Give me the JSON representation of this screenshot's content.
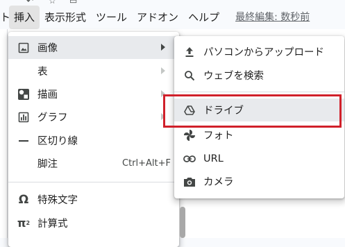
{
  "menubar": {
    "items": [
      {
        "label": "ト"
      },
      {
        "label": "挿入"
      },
      {
        "label": "表示形式"
      },
      {
        "label": "ツール"
      },
      {
        "label": "アドオン"
      },
      {
        "label": "ヘルプ"
      }
    ],
    "last_edit": "最終編集: 数秒前"
  },
  "insert_menu": {
    "items": [
      {
        "label": "画像",
        "icon": "image-icon"
      },
      {
        "label": "表"
      },
      {
        "label": "描画",
        "icon": "drawing-icon"
      },
      {
        "label": "グラフ",
        "icon": "chart-icon"
      },
      {
        "label": "区切り線",
        "icon": "horizontal-line-icon"
      },
      {
        "label": "脚注",
        "shortcut": "Ctrl+Alt+F"
      },
      {
        "label": "特殊文字",
        "icon": "omega-icon"
      },
      {
        "label": "計算式",
        "icon": "pi-squared-icon"
      }
    ]
  },
  "image_submenu": {
    "items": [
      {
        "label": "パソコンからアップロード",
        "icon": "upload-icon"
      },
      {
        "label": "ウェブを検索",
        "icon": "search-icon"
      },
      {
        "label": "ドライブ",
        "icon": "drive-icon"
      },
      {
        "label": "フォト",
        "icon": "photos-pinwheel-icon"
      },
      {
        "label": "URL",
        "icon": "link-icon"
      },
      {
        "label": "カメラ",
        "icon": "camera-icon"
      }
    ]
  },
  "colors": {
    "highlight_box": "#d0202a",
    "selected_row": "#e8eaed"
  }
}
